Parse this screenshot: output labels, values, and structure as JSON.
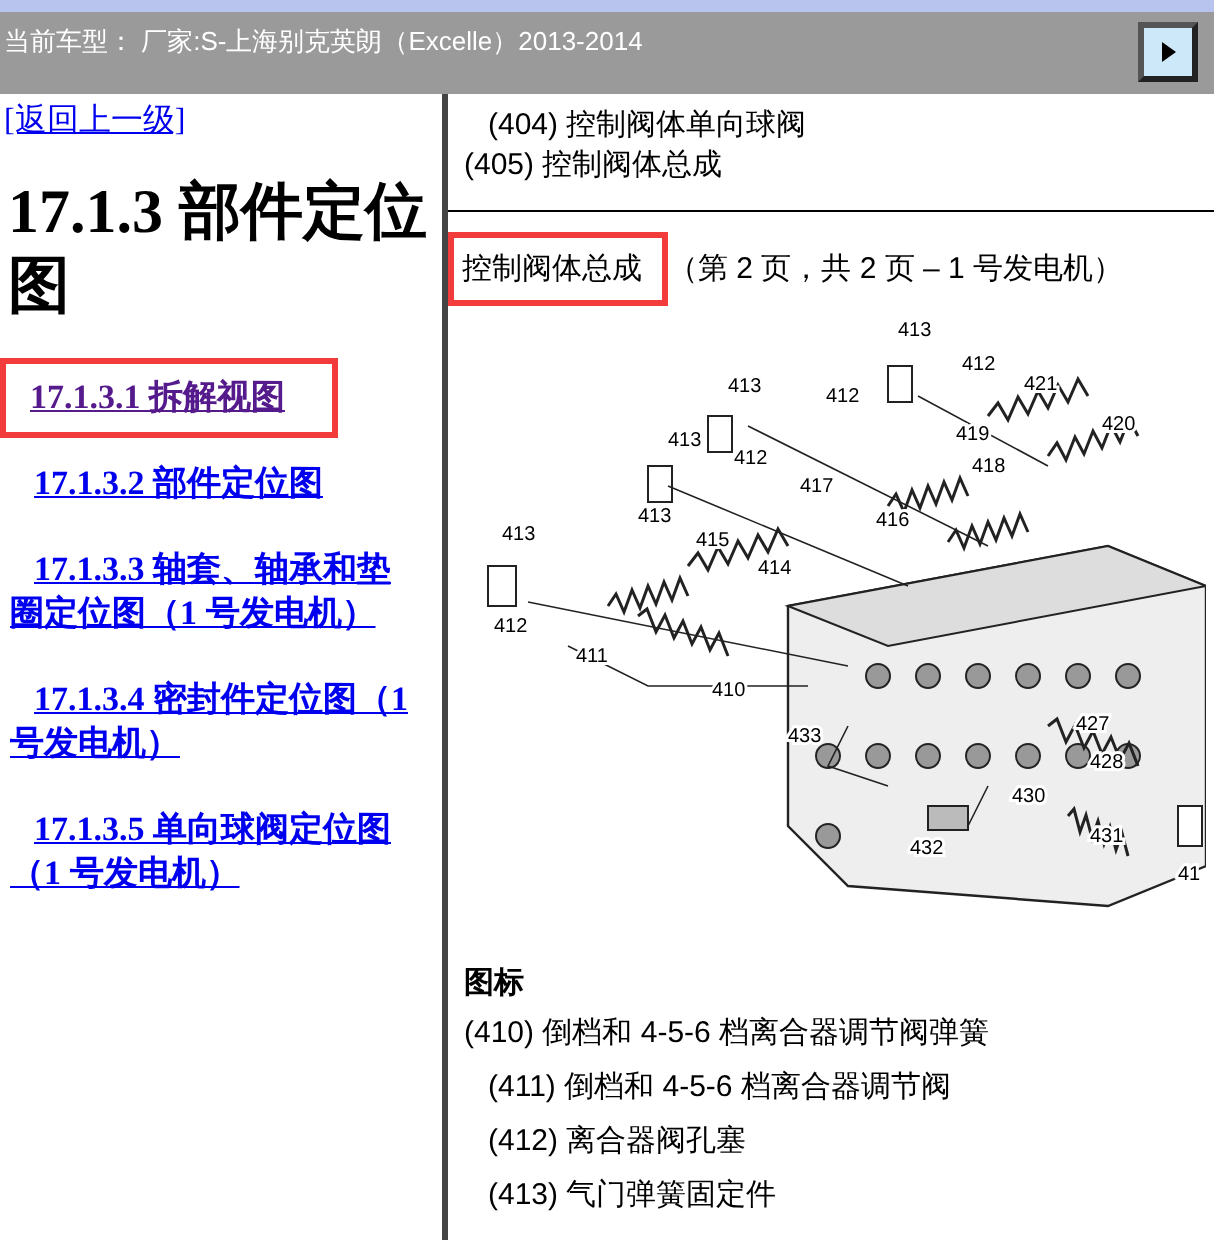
{
  "header": {
    "title": "当前车型： 厂家:S-上海别克英朗（Excelle）2013-2014"
  },
  "sidebar": {
    "back_link": "[返回上一级]",
    "heading": "17.1.3 部件定位图",
    "links": [
      {
        "label": "17.1.3.1 拆解视图",
        "visited": true,
        "highlighted": true
      },
      {
        "label": "17.1.3.2 部件定位图",
        "visited": false,
        "highlighted": false
      },
      {
        "label": "17.1.3.3 轴套、轴承和垫圈定位图（1 号发电机）",
        "visited": false,
        "highlighted": false
      },
      {
        "label": "17.1.3.4 密封件定位图（1 号发电机）",
        "visited": false,
        "highlighted": false
      },
      {
        "label": "17.1.3.5 单向球阀定位图（1 号发电机）",
        "visited": false,
        "highlighted": false
      }
    ]
  },
  "content": {
    "prev_items": [
      {
        "text": "(404) 控制阀体单向球阀",
        "indented": true
      },
      {
        "text": "(405) 控制阀体总成",
        "indented": false
      }
    ],
    "caption": {
      "title": "控制阀体总成",
      "title_highlighted": true,
      "suffix": "（第 2 页，共 2 页 – 1 号发电机）"
    },
    "callouts": [
      "413",
      "412",
      "421",
      "413",
      "412",
      "419",
      "420",
      "413",
      "412",
      "418",
      "417",
      "416",
      "413",
      "413",
      "415",
      "414",
      "412",
      "411",
      "410",
      "433",
      "427",
      "428",
      "430",
      "431",
      "432",
      "41"
    ],
    "legend_title": "图标",
    "legend": [
      {
        "text": "(410) 倒档和 4-5-6 档离合器调节阀弹簧",
        "indented": false
      },
      {
        "text": "(411) 倒档和 4-5-6 档离合器调节阀",
        "indented": true
      },
      {
        "text": "(412) 离合器阀孔塞",
        "indented": true
      },
      {
        "text": "(413) 气门弹簧固定件",
        "indented": true
      }
    ]
  }
}
